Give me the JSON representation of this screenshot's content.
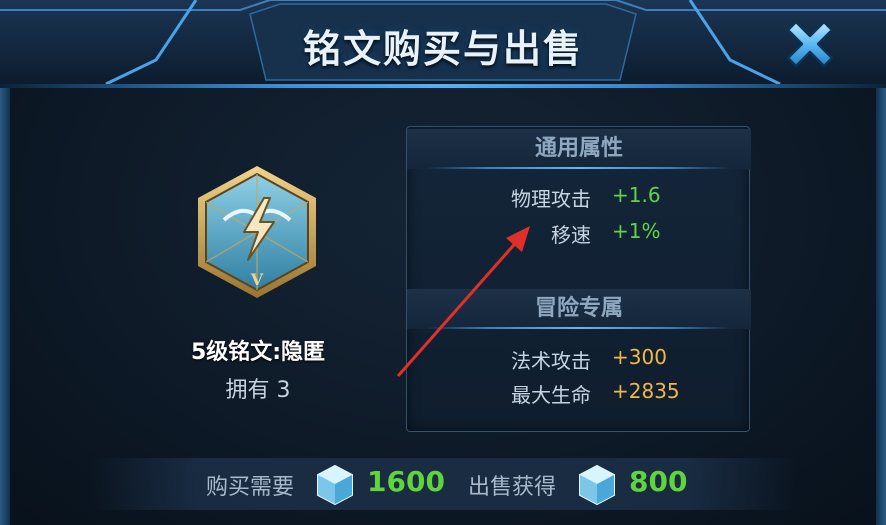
{
  "header": {
    "title": "铭文购买与出售"
  },
  "rune": {
    "name": "5级铭文:隐匿",
    "owned": "拥有 3",
    "level_mark": "V"
  },
  "attributes": {
    "general": {
      "title": "通用属性",
      "items": [
        {
          "label": "物理攻击",
          "value": "+1.6",
          "color": "#64d24b"
        },
        {
          "label": "移速",
          "value": "+1%",
          "color": "#64d24b"
        }
      ]
    },
    "adventure": {
      "title": "冒险专属",
      "items": [
        {
          "label": "法术攻击",
          "value": "+300",
          "color": "#f0b84a"
        },
        {
          "label": "最大生命",
          "value": "+2835",
          "color": "#f0b84a"
        }
      ]
    }
  },
  "footer": {
    "buy_label": "购买需要",
    "buy_price": "1600",
    "sell_label": "出售获得",
    "sell_price": "800",
    "price_color": "#5fd43c"
  },
  "icons": {
    "close": "close-x-icon",
    "currency": "diamond-gem-icon",
    "rune": "rune-hexagon-icon"
  }
}
